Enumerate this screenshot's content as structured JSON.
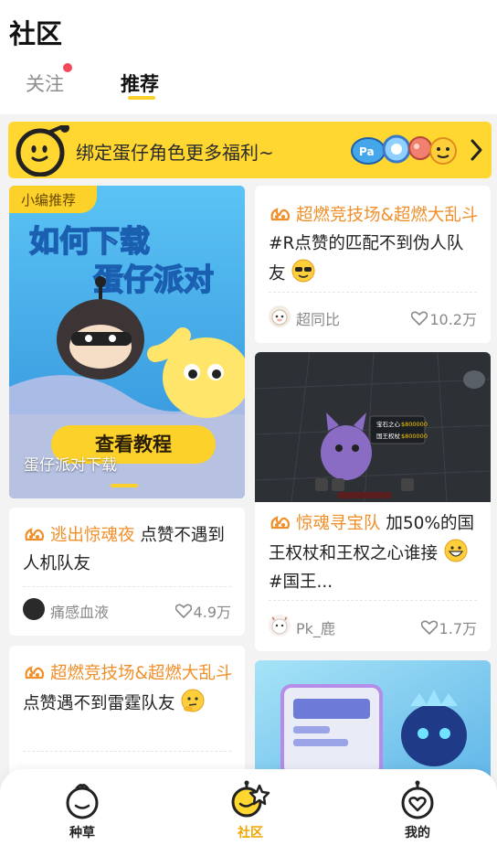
{
  "header": {
    "title": "社区",
    "tabs": [
      {
        "label": "关注",
        "has_dot": true
      },
      {
        "label": "推荐",
        "active": true
      }
    ]
  },
  "banner": {
    "text": "绑定蛋仔角色更多福利~"
  },
  "feed": {
    "col1": [
      {
        "tag": "小编推荐",
        "headline_line1": "如何下载",
        "headline_line2": "蛋仔派对",
        "button": "查看教程",
        "caption": "蛋仔派对下载"
      },
      {
        "topic": "逃出惊魂夜",
        "text": "点赞不遇到人机队友",
        "author": "痛感血液",
        "likes": "4.9万"
      },
      {
        "topic": "超燃竞技场&超燃大乱斗",
        "text": "点赞遇不到雷霆队友",
        "author": "",
        "likes": ""
      }
    ],
    "col2": [
      {
        "topic": "超燃竞技场&超燃大乱斗",
        "text": "#R点赞的匹配不到伪人队友",
        "author": "超同比",
        "likes": "10.2万"
      },
      {
        "topic": "惊魂寻宝队",
        "text_a": "加50%的国王权杖和王权之心谁接",
        "text_b": "#国王...",
        "author": "Pk_鹿",
        "likes": "1.7万",
        "hud_texts": [
          "宝石之心",
          "$800000",
          "国王权杖",
          "$800000"
        ]
      }
    ]
  },
  "tabbar": {
    "items": [
      {
        "label": "种草"
      },
      {
        "label": "社区",
        "active": true
      },
      {
        "label": "我的"
      }
    ]
  },
  "colors": {
    "accent": "#fcd12a",
    "topic": "#f08f2a",
    "notify_dot": "#f2495b",
    "active_tab_label": "#f0a500"
  }
}
